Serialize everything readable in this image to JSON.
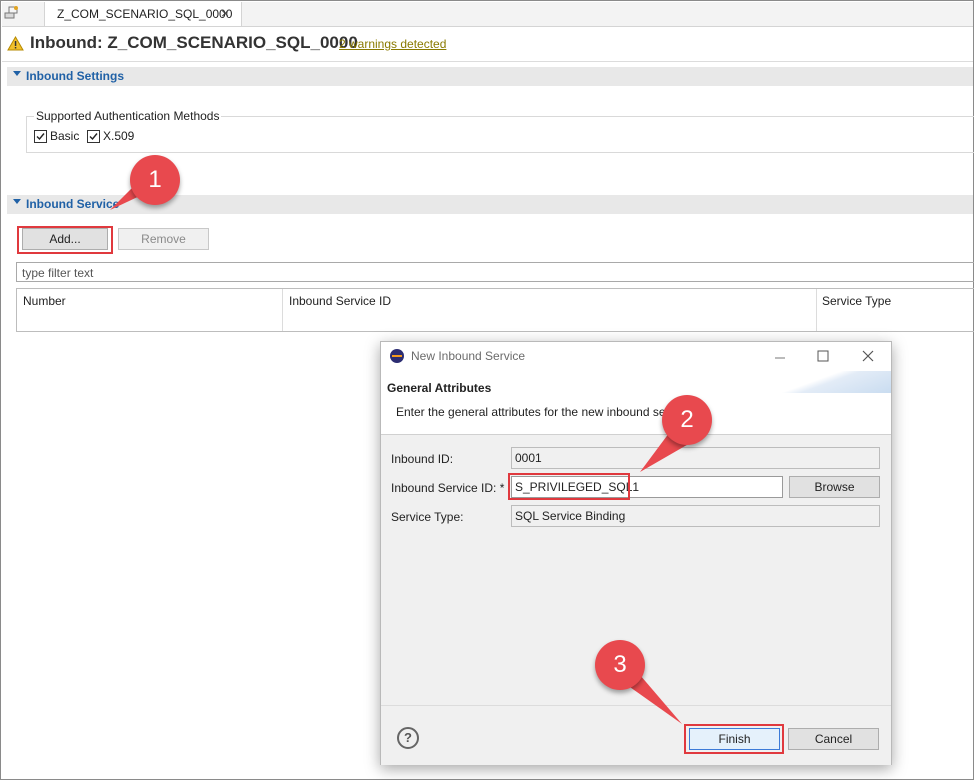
{
  "tab": {
    "label": "Z_COM_SCENARIO_SQL_0000",
    "close": "×"
  },
  "header": {
    "title": "Inbound: Z_COM_SCENARIO_SQL_0000",
    "warnings_link": "2 warnings detected"
  },
  "inbound_settings": {
    "title": "Inbound Settings",
    "auth_group_label": "Supported Authentication Methods",
    "methods": [
      {
        "label": "Basic",
        "checked": true
      },
      {
        "label": "X.509",
        "checked": true
      }
    ]
  },
  "inbound_services": {
    "title": "Inbound Service",
    "add_label": "Add...",
    "remove_label": "Remove",
    "filter_placeholder": "type filter text",
    "columns": [
      "Number",
      "Inbound Service ID",
      "Service Type"
    ]
  },
  "dialog": {
    "title": "New Inbound Service",
    "heading": "General Attributes",
    "description": "Enter the general attributes for the new inbound se",
    "fields": {
      "inbound_id_label": "Inbound ID:",
      "inbound_id_value": "0001",
      "service_id_label": "Inbound Service ID: *",
      "service_id_value": "S_PRIVILEGED_SQL1",
      "service_type_label": "Service Type:",
      "service_type_value": "SQL Service Binding"
    },
    "browse_label": "Browse",
    "finish_label": "Finish",
    "cancel_label": "Cancel",
    "help_glyph": "?"
  },
  "callouts": [
    "1",
    "2",
    "3"
  ],
  "colors": {
    "accent": "#2061a6",
    "highlight": "#e0393e",
    "badge": "#e8494e"
  }
}
